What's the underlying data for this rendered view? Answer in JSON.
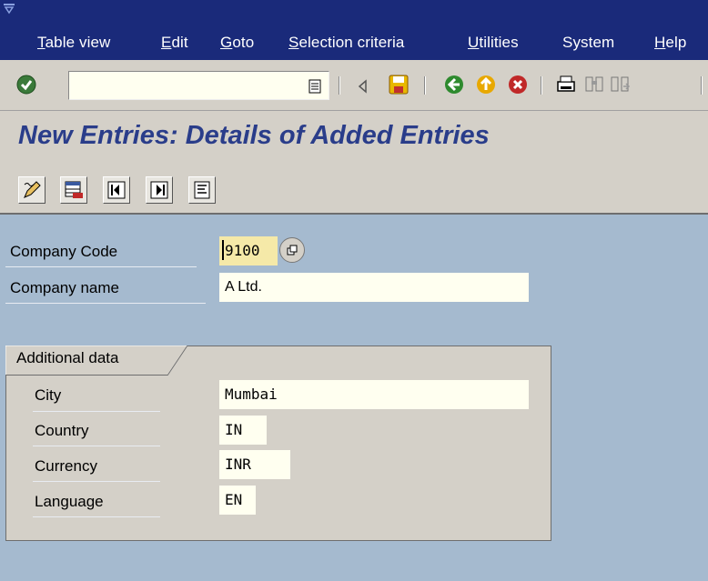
{
  "menu": {
    "items": [
      "Table view",
      "Edit",
      "Goto",
      "Selection criteria",
      "Utilities",
      "System",
      "Help"
    ],
    "underlined": [
      "T",
      "E",
      "G",
      "S",
      "U",
      "",
      "H"
    ]
  },
  "toolbar": {
    "command_value": "",
    "icons": [
      "enter-icon",
      "command-history-icon",
      "back-arrow-icon",
      "save-icon",
      "back-icon",
      "exit-icon",
      "cancel-icon",
      "print-icon",
      "find-icon",
      "find-next-icon"
    ]
  },
  "title": "New Entries: Details of Added Entries",
  "app_toolbar": {
    "icons": [
      "change-icon",
      "delete-row-icon",
      "previous-entry-icon",
      "next-entry-icon",
      "details-icon"
    ]
  },
  "fields": {
    "company_code": {
      "label": "Company Code",
      "value": "9100"
    },
    "company_name": {
      "label": "Company name",
      "value": "A Ltd."
    }
  },
  "group": {
    "title": "Additional data",
    "city": {
      "label": "City",
      "value": "Mumbai"
    },
    "country": {
      "label": "Country",
      "value": "IN"
    },
    "currency": {
      "label": "Currency",
      "value": "INR"
    },
    "language": {
      "label": "Language",
      "value": "EN"
    }
  },
  "colors": {
    "menubar": "#1a2a7a",
    "background": "#a5bacf",
    "title": "#2a3d8a",
    "input": "#fffff0",
    "focused_input": "#f5e9a8"
  }
}
